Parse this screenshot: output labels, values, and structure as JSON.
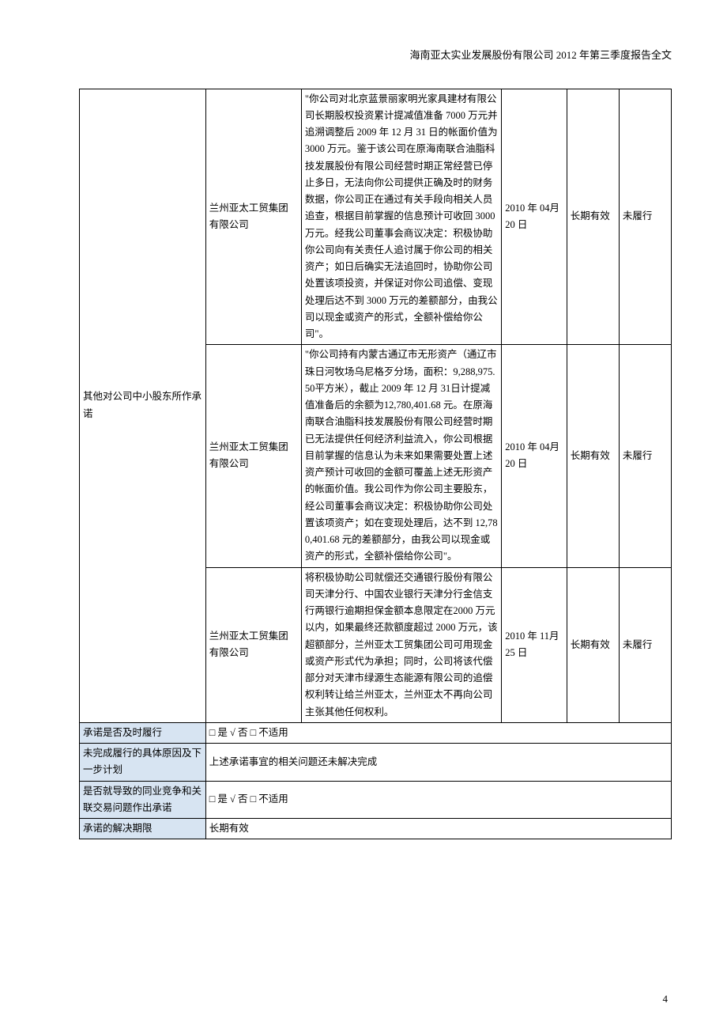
{
  "header": "海南亚太实业发展股份有限公司 2012 年第三季度报告全文",
  "pagenum": "4",
  "table": {
    "leftLabel": "其他对公司中小股东所作承诺",
    "rows": [
      {
        "party": "兰州亚太工贸集团有限公司",
        "partySuffix": "公司正在通过有关手段向相关人员追查，根据目前掌握的信息",
        "content": "\"你公司对北京蓝景丽家明光家具建材有限公司长期股权投资累计提减值准备 7000 万元并追溯调整后 2009 年 12 月 31 日的帐面价值为 3000 万元。鉴于该公司在原海南联合油脂科技发展股份有限公司经营时期正常经营已停止多日，无法向你公司提供正确及时的财务数据，你公司正在通过有关手段向相关人员追查，根据目前掌握的信息预计可收回 3000 万元。经我公司董事会商议决定：积极协助你公司向有关责任人追讨属于你公司的相关资产；如日后确实无法追回时，协助你公司处置该项投资，并保证对你公司追偿、变现处理后达不到 3000 万元的差额部分，由我公司以现金或资产的形式，全额补偿给你公司\"。",
        "date": "2010 年 04月 20 日",
        "term": "长期有效",
        "status": "未履行"
      },
      {
        "party": "兰州亚太工贸集团有限公司",
        "content": "\"你公司持有内蒙古通辽市无形资产（通辽市珠日河牧场乌尼格歹分场，面积：9,288,975.50平方米），截止 2009 年 12 月 31日计提减值准备后的余额为12,780,401.68 元。在原海南联合油脂科技发展股份有限公司经营时期已无法提供任何经济利益流入，你公司根据目前掌握的信息认为未来如果需要处置上述资产预计可收回的金额可覆盖上述无形资产的帐面价值。我公司作为你公司主要股东，经公司董事会商议决定：积极协助你公司处置该项资产；如在变现处理后，达不到 12,780,401.68 元的差额部分，由我公司以现金或资产的形式，全额补偿给你公司\"。",
        "date": "2010 年 04月 20 日",
        "term": "长期有效",
        "status": "未履行"
      },
      {
        "party": "兰州亚太工贸集团有限公司",
        "partySuffix": "额度超过 2000 万元，该超额部分，兰州亚太工贸集团公司可用",
        "content": "将积极协助公司就偿还交通银行股份有限公司天津分行、中国农业银行天津分行金信支行两银行逾期担保金额本息限定在2000 万元以内，如果最终还款额度超过 2000 万元，该超额部分，兰州亚太工贸集团公司可用现金或资产形式代为承担；同时，公司将该代偿部分对天津市绿源生态能源有限公司的追偿权利转让给兰州亚太，兰州亚太不再向公司主张其他任何权利。",
        "date": "2010 年 11月 25 日",
        "term": "长期有效",
        "status": "未履行"
      }
    ],
    "footer": [
      {
        "label": "承诺是否及时履行",
        "value": "□ 是 √ 否 □ 不适用"
      },
      {
        "label": "未完成履行的具体原因及下一步计划",
        "value": "上述承诺事宜的相关问题还未解决完成"
      },
      {
        "label": "是否就导致的同业竞争和关联交易问题作出承诺",
        "value": "□ 是 √ 否 □ 不适用"
      },
      {
        "label": "承诺的解决期限",
        "value": "长期有效"
      }
    ]
  }
}
